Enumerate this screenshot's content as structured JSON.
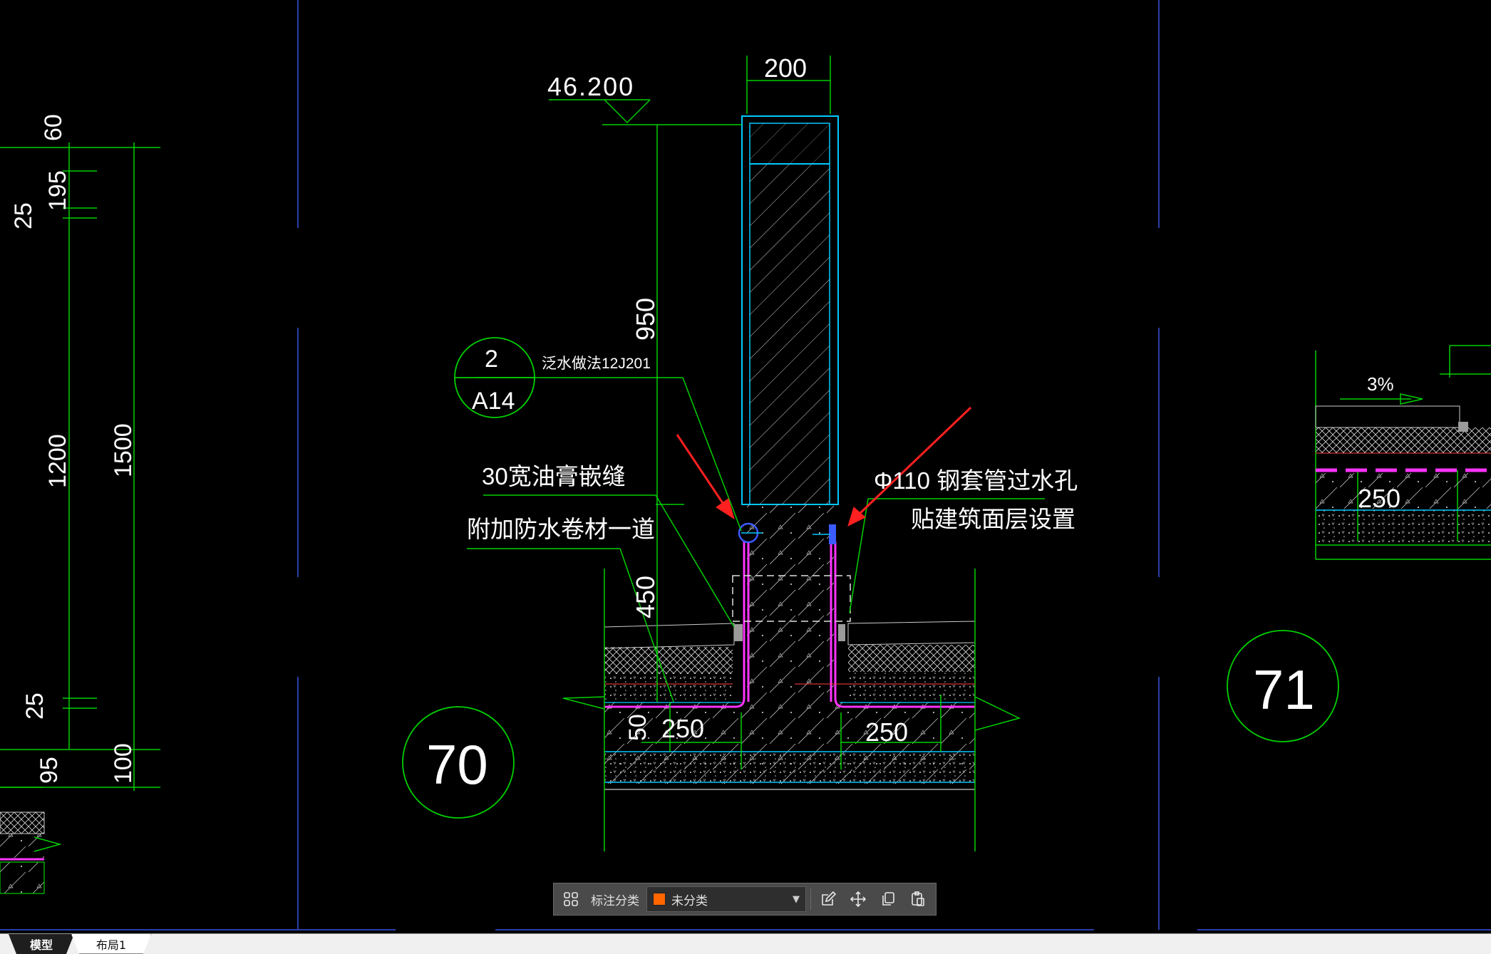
{
  "colors": {
    "background": "#000000",
    "dimension_line": "#00e000",
    "outline": "#00c8ff",
    "magenta": "#ff33ff",
    "text": "#ffffff",
    "arrow": "#ff2020",
    "category_swatch": "#ff6600"
  },
  "drawing": {
    "elev_label": "46.200",
    "detail_70": "70",
    "detail_71": "71",
    "callout_num": "2",
    "callout_sheet": "A14",
    "ref_note": "泛水做法12J201",
    "note_joint": "30宽油膏嵌缝",
    "note_membrane": "附加防水卷材一道",
    "note_pipe_1": "Φ110 钢套管过水孔",
    "note_pipe_2": "贴建筑面层设置",
    "dim_wall_width": "200",
    "dim_parapet_height": "950",
    "dim_base_height": "450",
    "dim_slab": "50",
    "dim_left_width": "250",
    "dim_right_width": "250",
    "left_dims": {
      "d60": "60",
      "d195": "195",
      "d25a": "25",
      "d1200": "1200",
      "d1500": "1500",
      "d25b": "25",
      "d95": "95",
      "d100": "100"
    },
    "right_detail": {
      "slope": "3%",
      "width": "250"
    }
  },
  "toolbar": {
    "label": "标注分类",
    "select_value": "未分类",
    "icons": [
      "grid-icon",
      "edit-icon",
      "move-icon",
      "copy-icon",
      "paste-icon"
    ]
  },
  "tabs": {
    "model": "模型",
    "layout1": "布局1"
  }
}
